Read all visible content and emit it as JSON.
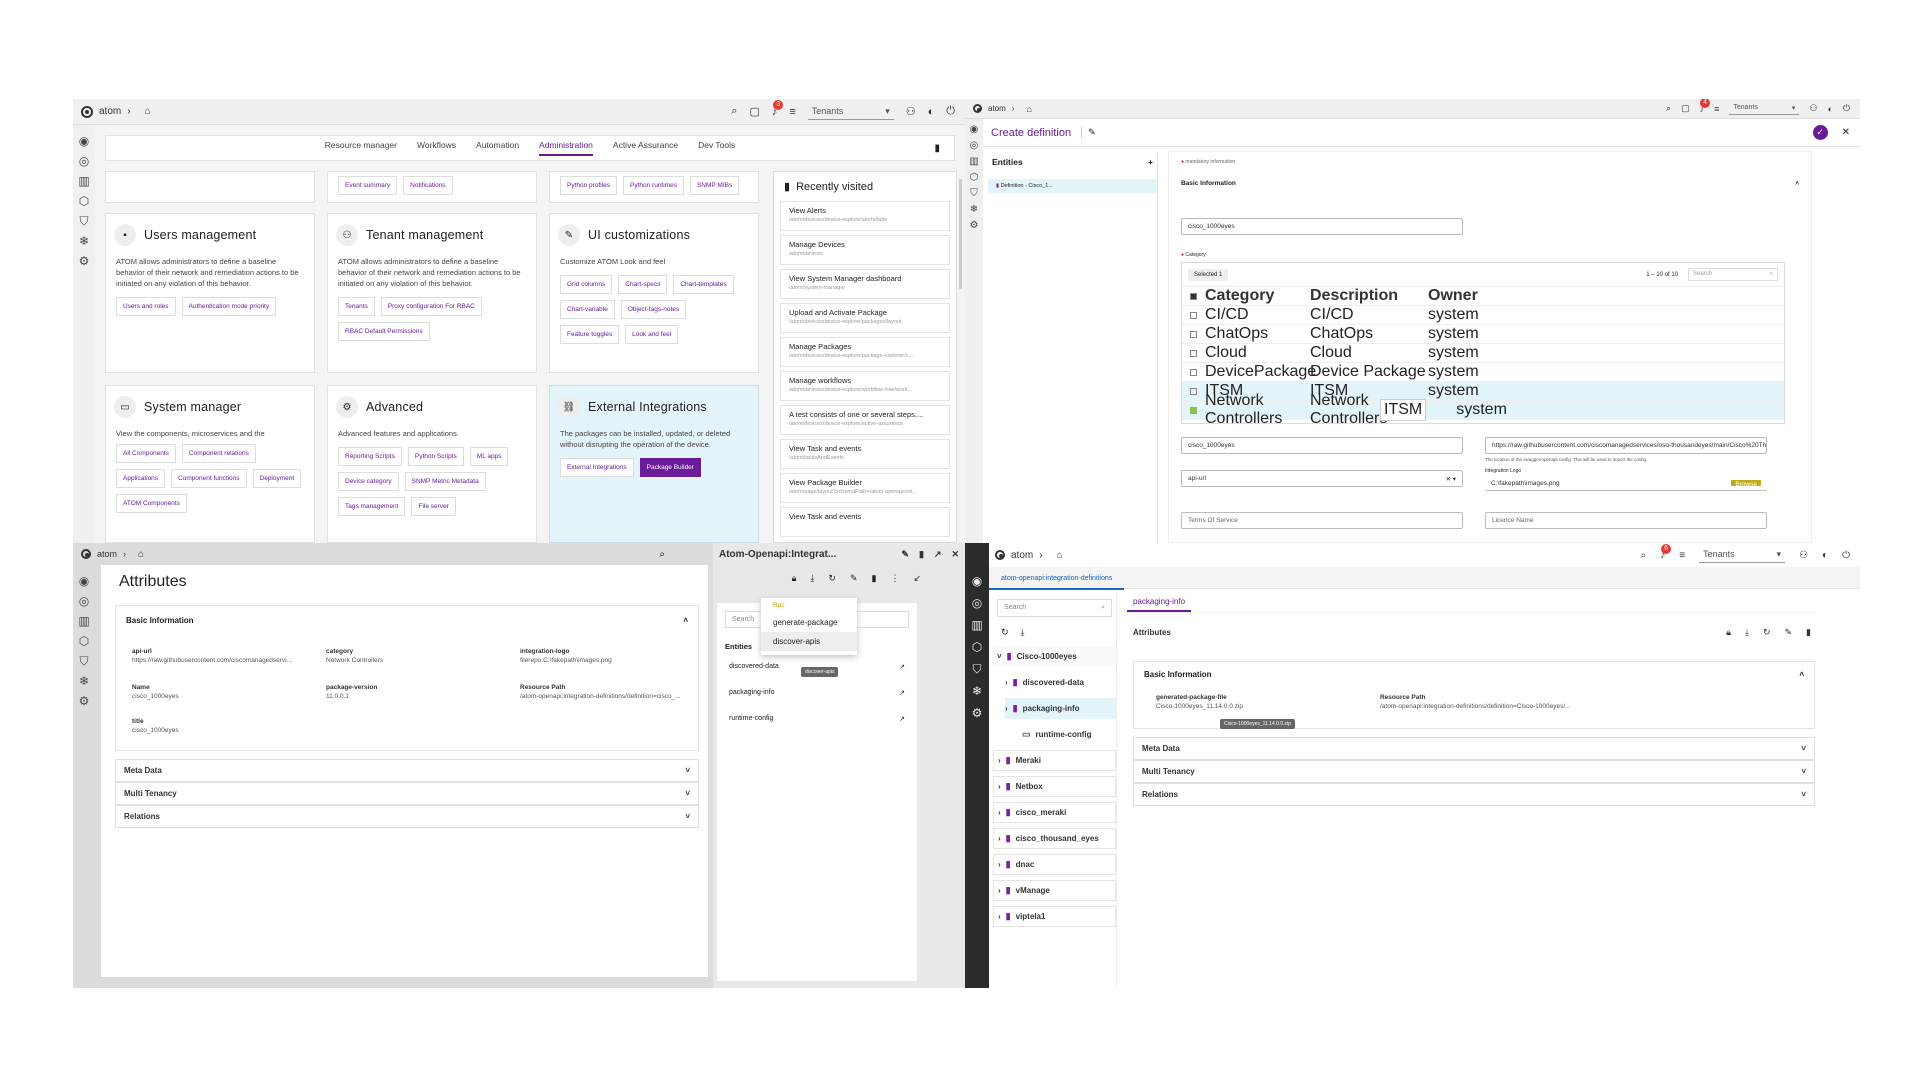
{
  "brand": "atom",
  "p1": {
    "tenants": "Tenants",
    "nav_tabs": [
      "Resource manager",
      "Workflows",
      "Automation",
      "Administration",
      "Active Assurance",
      "Dev Tools"
    ],
    "top_chips_1": [
      "Event summary",
      "Notifications"
    ],
    "top_chips_2": [
      "Python profiles",
      "Python runtimes",
      "SNMP MIBs"
    ],
    "cards": [
      {
        "title": "Users management",
        "desc": "ATOM allows administrators to define a baseline behavior of their network and remediation actions to be initiated on any violation of this behavior.",
        "chips": [
          "Users and roles",
          "Authentication mode priority"
        ]
      },
      {
        "title": "Tenant management",
        "desc": "ATOM allows administrators to define a baseline behavior of their network and remediation actions to be initiated on any violation of this behavior.",
        "chips": [
          "Tenants",
          "Proxy configuration For RBAC",
          "RBAC Default Permissions"
        ]
      },
      {
        "title": "UI customizations",
        "desc": "Customize ATOM Look and feel",
        "chips": [
          "Grid columns",
          "Chart-specs",
          "Chart-templates",
          "Chart-variable",
          "Object-tags-notes",
          "Feature toggles",
          "Look and feel"
        ]
      },
      {
        "title": "System manager",
        "desc": "View the components, microservices and the applications managed by ATOM",
        "chips": [
          "All Components",
          "Component relations",
          "Applications",
          "Component functions",
          "Deployment",
          "ATOM Components"
        ]
      },
      {
        "title": "Advanced",
        "desc": "Advanced features and applications.",
        "chips": [
          "Reporting Scripts",
          "Python Scripts",
          "ML apps",
          "Device category",
          "SNMP Metric Metadata",
          "Tags management",
          "File server"
        ]
      },
      {
        "title": "External Integrations",
        "desc": "The packages can be installed, updated, or deleted without disrupting the operation of the device.",
        "chips": [
          "External Integrations",
          "Package Builder"
        ]
      }
    ],
    "recent_title": "Recently visited",
    "recent": [
      {
        "t": "View Alerts",
        "s": "/atom/devices/device-explore/alerts/tabs"
      },
      {
        "t": "Manage Devices",
        "s": "/atom/devices"
      },
      {
        "t": "View System Manager dashboard",
        "s": "/atom/system-manager"
      },
      {
        "t": "Upload and Activate Package",
        "s": "/atom/devices/device-explore/packages/layout"
      },
      {
        "t": "Manage Packages",
        "s": "/atom/devices/device-explore/package-explorer/c..."
      },
      {
        "t": "Manage workflows",
        "s": "/atom/devices/device-explore/workflow-tree/work..."
      },
      {
        "t": "A test consists of one or several steps,...",
        "s": "/atom/devices/device-explore/active-assurance"
      },
      {
        "t": "View Task and events",
        "s": "/atom/tasksAndEvents"
      },
      {
        "t": "View Package Builder",
        "s": "/atom/page/layout?schemaPath=/atom-openapi:int..."
      },
      {
        "t": "View Task and events",
        "s": ""
      }
    ]
  },
  "p2": {
    "tenants": "Tenants",
    "title": "Create definition",
    "entities": "Entities",
    "entity_item": "Definition - Cisco_1...",
    "mandatory": "mandatory information",
    "basic_info": "Basic Information",
    "name_label": "Name",
    "name_value": "cisco_1000eyes",
    "category_label": "Category",
    "selected": "Selected 1",
    "pager": "1 – 10 of 10",
    "search": "Search",
    "cols": [
      "Category",
      "Description",
      "Owner"
    ],
    "rows": [
      {
        "c": "CI/CD",
        "d": "CI/CD",
        "o": "system",
        "sel": false,
        "on": false
      },
      {
        "c": "ChatOps",
        "d": "ChatOps",
        "o": "system",
        "sel": false,
        "on": false
      },
      {
        "c": "Cloud",
        "d": "Cloud",
        "o": "system",
        "sel": false,
        "on": false
      },
      {
        "c": "DevicePackage",
        "d": "Device Package",
        "o": "system",
        "sel": false,
        "on": false
      },
      {
        "c": "ITSM",
        "d": "ITSM",
        "o": "system",
        "sel": true,
        "on": false
      },
      {
        "c": "Network Controllers",
        "d": "Network Controllers",
        "o": "system",
        "sel": true,
        "on": true
      }
    ],
    "tooltip": "ITSM",
    "title_field": "cisco_1000eyes",
    "api_url": "https://raw.githubusercontent.com/ciscomanagedservices/oso-thousandeyes/main/Cisco%20Th",
    "api_hint": "The location of the swagger/openapi config. This will be used to import the config.",
    "api_type": "api-url",
    "logo_label": "Integration Logo",
    "logo_value": "C:\\fakepath\\images.png",
    "browse": "Browse",
    "terms": "Terms Of Service",
    "license": "Licence Name"
  },
  "p3": {
    "title": "Attributes",
    "side_title": "Atom-Openapi:Integrat...",
    "basic_info": "Basic Information",
    "attrs": [
      {
        "k": "api-url",
        "v": "https://raw.githubusercontent.com/ciscomanagedservi..."
      },
      {
        "k": "category",
        "v": "Network Controllers"
      },
      {
        "k": "integration-logo",
        "v": "filerepo:C:\\fakepath\\images.png"
      },
      {
        "k": "Name",
        "v": "cisco_1000eyes"
      },
      {
        "k": "package-version",
        "v": "11.0.0.1"
      },
      {
        "k": "Resource Path",
        "v": "/atom-openapi:integration-definitions/definition=cisco_..."
      },
      {
        "k": "title",
        "v": "cisco_1000eyes"
      }
    ],
    "sections": [
      "Meta Data",
      "Multi Tenancy",
      "Relations"
    ],
    "search": "Search",
    "entities": "Entities",
    "entity_items": [
      "discovered-data",
      "packaging-info",
      "runtime-config"
    ],
    "menu_head": "Rpc",
    "menu_items": [
      "generate-package",
      "discover-apis"
    ],
    "menu_tip": "discover-apis"
  },
  "p4": {
    "tenants": "Tenants",
    "crumb": "atom-openapi:integration-definitions",
    "tab": "packaging-info",
    "search": "Search",
    "tree": [
      {
        "n": "Cisco-1000eyes",
        "lvl": 0
      },
      {
        "n": "discovered-data",
        "lvl": 1
      },
      {
        "n": "packaging-info",
        "lvl": 1
      },
      {
        "n": "runtime-config",
        "lvl": 2
      },
      {
        "n": "Meraki",
        "lvl": 0
      },
      {
        "n": "Netbox",
        "lvl": 0
      },
      {
        "n": "cisco_meraki",
        "lvl": 0
      },
      {
        "n": "cisco_thousand_eyes",
        "lvl": 0
      },
      {
        "n": "dnac",
        "lvl": 0
      },
      {
        "n": "vManage",
        "lvl": 0
      },
      {
        "n": "viptela1",
        "lvl": 0
      }
    ],
    "attributes": "Attributes",
    "basic_info": "Basic Information",
    "attrs": [
      {
        "k": "generated-package-file",
        "v": "Cisco-1000eyes_11.14.0.0.zip"
      },
      {
        "k": "Resource Path",
        "v": "/atom-openapi:integration-definitions/definition=Cisco-1000eyes/..."
      }
    ],
    "tip": "Cisco-1000eyes_11.14.0.0.zip",
    "sections": [
      "Meta Data",
      "Multi Tenancy",
      "Relations"
    ]
  }
}
